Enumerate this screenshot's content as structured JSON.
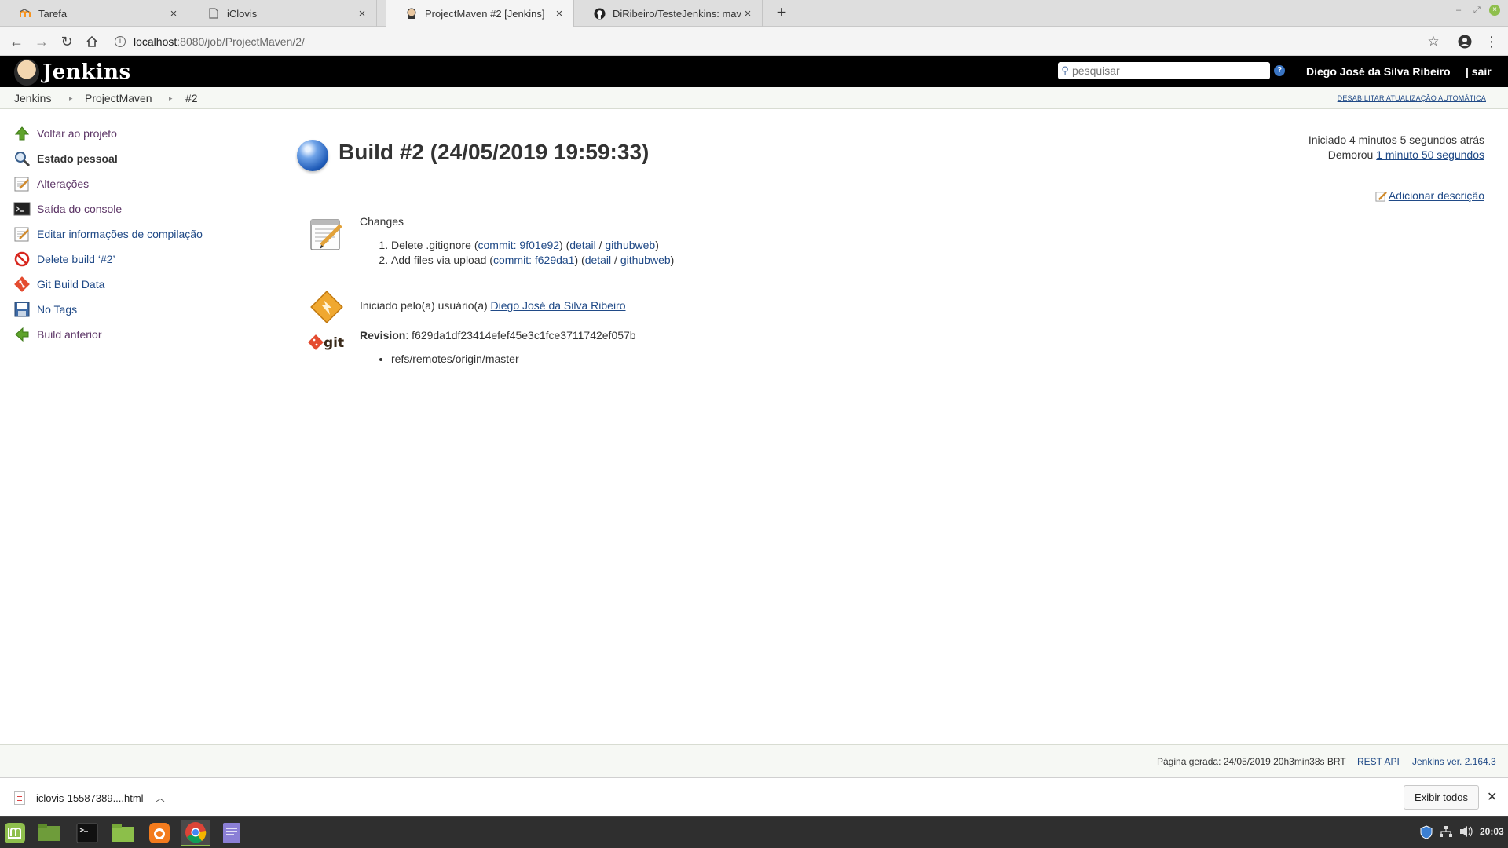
{
  "browser": {
    "tabs": [
      {
        "title": "Tarefa",
        "icon": "moodle-icon"
      },
      {
        "title": "iClovis",
        "icon": "page-icon"
      },
      {
        "title": "ProjectMaven #2 [Jenkins]",
        "icon": "jenkins-icon"
      },
      {
        "title": "DiRibeiro/TesteJenkins: maven",
        "icon": "github-icon"
      }
    ],
    "url_host": "localhost",
    "url_path": ":8080/job/ProjectMaven/2/"
  },
  "jenkins": {
    "logo_text": "Jenkins",
    "search_placeholder": "pesquisar",
    "user": "Diego José da Silva Ribeiro",
    "logout": "| sair",
    "breadcrumbs": [
      "Jenkins",
      "ProjectMaven",
      "#2"
    ],
    "auto_refresh": "DESABILITAR ATUALIZAÇÃO AUTOMÁTICA"
  },
  "sidebar": {
    "items": [
      {
        "label": "Voltar ao projeto",
        "icon": "up-arrow-icon"
      },
      {
        "label": "Estado pessoal",
        "icon": "magnifier-icon"
      },
      {
        "label": "Alterações",
        "icon": "notepad-icon"
      },
      {
        "label": "Saída do console",
        "icon": "terminal-icon"
      },
      {
        "label": "Editar informações de compilação",
        "icon": "notepad-icon"
      },
      {
        "label": "Delete build ‘#2’",
        "icon": "no-entry-icon"
      },
      {
        "label": "Git Build Data",
        "icon": "git-icon"
      },
      {
        "label": "No Tags",
        "icon": "save-icon"
      },
      {
        "label": "Build anterior",
        "icon": "left-arrow-icon"
      }
    ]
  },
  "build": {
    "title": "Build #2 (24/05/2019 19:59:33)",
    "started": "Iniciado 4 minutos 5 segundos atrás",
    "took_label": "Demorou",
    "took_value": "1 minuto 50 segundos",
    "add_description": "Adicionar descrição",
    "changes_heading": "Changes",
    "changes": [
      {
        "prefix": "Delete .gitignore (",
        "commit": "commit: 9f01e92",
        "detail": "detail",
        "githubweb": "githubweb"
      },
      {
        "prefix": "Add files via upload (",
        "commit": "commit: f629da1",
        "detail": "detail",
        "githubweb": "githubweb"
      }
    ],
    "started_by_prefix": "Iniciado pelo(a) usuário(a)",
    "started_by_user": "Diego José da Silva Ribeiro",
    "revision_label": "Revision",
    "revision_value": ": f629da1df23414efef45e3c1fce3711742ef057b",
    "refs": [
      "refs/remotes/origin/master"
    ]
  },
  "footer": {
    "generated": "Página gerada: 24/05/2019 20h3min38s BRT",
    "rest_api": "REST API",
    "version": "Jenkins ver. 2.164.3"
  },
  "downloads": {
    "file": "iclovis-15587389....html",
    "show_all": "Exibir todos"
  },
  "taskbar": {
    "clock": "20:03"
  }
}
